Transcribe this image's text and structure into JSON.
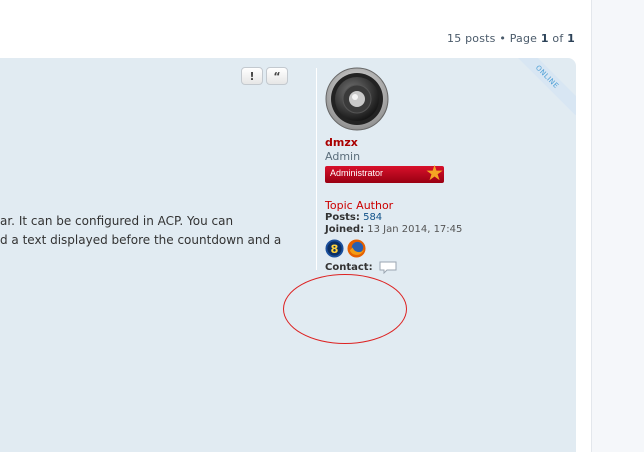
{
  "pagination": {
    "posts_text": "15 posts",
    "bullet": "•",
    "page_word": "Page",
    "current_page": "1",
    "of_word": "of",
    "total_pages": "1"
  },
  "post": {
    "buttons": [
      {
        "icon": "report-icon",
        "glyph": "!"
      },
      {
        "icon": "quote-icon",
        "glyph": "“"
      }
    ],
    "text_lines": [
      "ar. It can be configured in ACP. You can",
      "d a text displayed before the countdown and a"
    ]
  },
  "profile": {
    "status_ribbon": "ONLINE",
    "avatar_icon": "speaker-icon",
    "username": "dmzx",
    "rank": "Admin",
    "rank_badge": "Administrator",
    "topic_author": "Topic Author",
    "posts_label": "Posts:",
    "posts_value": "584",
    "joined_label": "Joined:",
    "joined_value": "13 Jan 2014, 17:45",
    "browser_icons": [
      "windows8-icon",
      "firefox-icon"
    ],
    "contact_label": "Contact:",
    "contact_icon": "speech-bubble-icon"
  },
  "colors": {
    "post_bg": "#e1ebf2",
    "username": "#aa0000",
    "badge": "#cc0a20",
    "annotation_circle": "#dd2222"
  }
}
